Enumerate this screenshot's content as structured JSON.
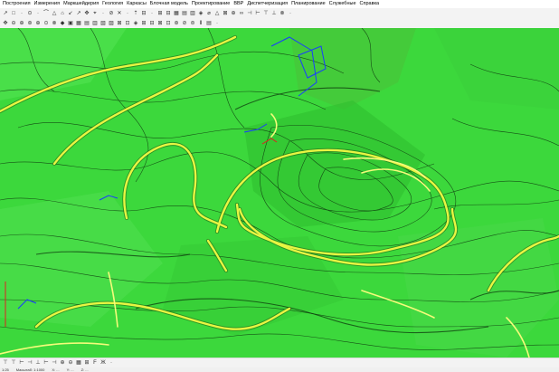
{
  "menu": {
    "items": [
      "Построения",
      "Измерения",
      "Маркшейдерия",
      "Геология",
      "Каркасы",
      "Блочная модель",
      "Проектирование",
      "ВВР",
      "Диспетчеризация",
      "Планирование",
      "Служебные",
      "Справка"
    ]
  },
  "toolbar1": {
    "glyphs": [
      "↗",
      "□",
      "·",
      "⊙",
      "·",
      "⌒",
      "△",
      "⌂",
      "↙",
      "↗",
      "✥",
      "⌖",
      "·",
      "⊘",
      "✕",
      "·",
      "⇡",
      "⊟",
      "·",
      "⊞",
      "⊟",
      "▦",
      "▤",
      "▥",
      "◈",
      "⌀",
      "△",
      "⊠",
      "⊕",
      "∞",
      "⊣",
      "⊢",
      "⊤",
      "⊥",
      "⊗",
      "·"
    ]
  },
  "toolbar2": {
    "glyphs": [
      "✥",
      "⊖",
      "⊕",
      "⊛",
      "⊕",
      "⊙",
      "⊗",
      "◆",
      "▣",
      "▦",
      "▤",
      "▥",
      "▧",
      "▨",
      "⊠",
      "⊡",
      "◈",
      "⊞",
      "⊟",
      "⊠",
      "⊡",
      "⊛",
      "⊘",
      "⊜",
      "Ⅱ",
      "▤",
      "·"
    ]
  },
  "bottom_toolbar": {
    "glyphs": [
      "⊤",
      "⊤",
      "⊢",
      "⊣",
      "⊥",
      "⊢",
      "⊣",
      "⊕",
      "⊖",
      "▦",
      "⊞",
      "F",
      "Ж",
      "·"
    ]
  },
  "status": {
    "scale": "1:25",
    "coords": [
      "Масштаб: 1:1000",
      "X: ...",
      "Y: ...",
      "Z: ..."
    ]
  },
  "colors": {
    "terrain_green": "#3cd83c",
    "road_yellow": "#e8f542",
    "contour_dark": "#0f3a0f",
    "selection_blue": "#1a3cff",
    "marker_red": "#e02020"
  }
}
